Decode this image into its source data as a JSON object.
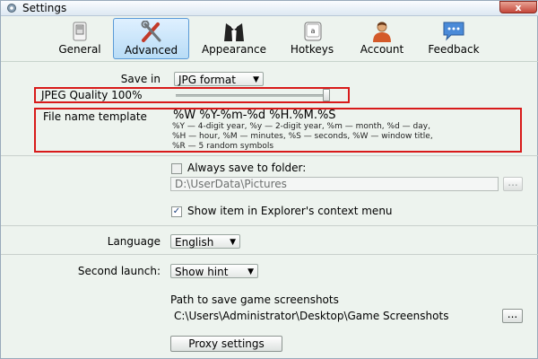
{
  "window": {
    "title": "Settings",
    "close_label": "x"
  },
  "tabs": [
    {
      "label": "General",
      "icon": "switch-icon"
    },
    {
      "label": "Advanced",
      "icon": "tools-icon",
      "active": true
    },
    {
      "label": "Appearance",
      "icon": "tuxedo-icon"
    },
    {
      "label": "Hotkeys",
      "icon": "keyboard-key-icon"
    },
    {
      "label": "Account",
      "icon": "user-icon"
    },
    {
      "label": "Feedback",
      "icon": "speech-bubble-icon"
    }
  ],
  "save_in": {
    "label": "Save in",
    "value": "JPG format"
  },
  "jpeg_quality": {
    "label": "JPEG Quality 100%",
    "percent": 100
  },
  "file_name_template": {
    "label": "File name template",
    "value": "%W %Y-%m-%d %H.%M.%S",
    "help_line1": "%Y — 4-digit year, %y — 2-digit year, %m — month, %d — day,",
    "help_line2": "%H — hour, %M — minutes, %S — seconds, %W — window title,",
    "help_line3": "%R — 5 random symbols"
  },
  "always_save": {
    "label": "Always save to folder:",
    "checked": false,
    "path": "D:\\UserData\\Pictures",
    "browse_label": "..."
  },
  "context_menu": {
    "label": "Show item in Explorer's context menu",
    "checked": true
  },
  "language": {
    "label": "Language",
    "value": "English"
  },
  "second_launch": {
    "label": "Second launch:",
    "value": "Show hint"
  },
  "game_screenshots": {
    "label": "Path to save game screenshots",
    "path": "C:\\Users\\Administrator\\Desktop\\Game Screenshots",
    "browse_label": "..."
  },
  "proxy": {
    "label": "Proxy settings"
  },
  "colors": {
    "highlight_box": "#d81a1a",
    "active_tab": "#b8dcf6",
    "background": "#edf3ee"
  }
}
